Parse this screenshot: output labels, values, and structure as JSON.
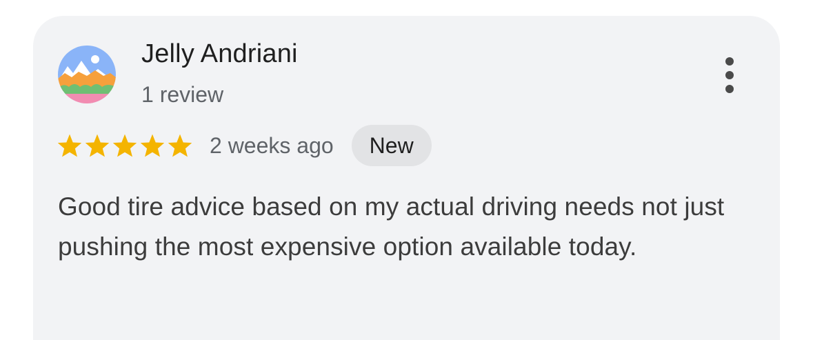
{
  "review": {
    "author": {
      "name": "Jelly Andriani",
      "review_count": "1 review",
      "avatar_icon": "mountain-landscape-avatar"
    },
    "rating": 5,
    "max_rating": 5,
    "star_color": "#f4b400",
    "time_ago": "2 weeks ago",
    "badge": "New",
    "text": "Good tire advice based on my actual driving needs not just pushing the most expensive option available today.",
    "menu_icon": "more-vertical-icon"
  }
}
